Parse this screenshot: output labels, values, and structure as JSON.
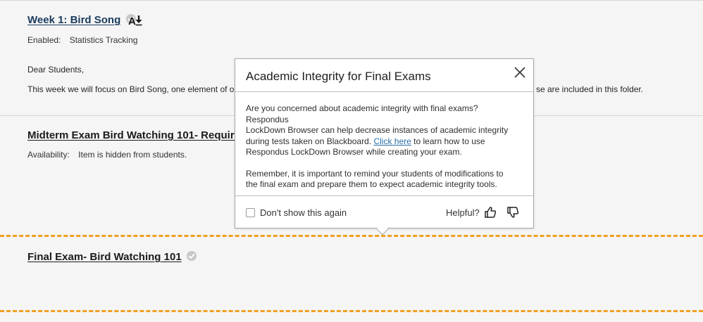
{
  "items": {
    "week1": {
      "title": "Week 1: Bird Song",
      "enabled_label": "Enabled:",
      "enabled_value": "Statistics Tracking",
      "greeting": "Dear Students,",
      "body_left": "This week we will focus on Bird Song, one element of ou",
      "body_right": "se are included in this folder."
    },
    "midterm": {
      "title": "Midterm Exam Bird Watching 101- Requires",
      "availability_label": "Availability:",
      "availability_value": "Item is hidden from students."
    },
    "final": {
      "title": "Final Exam- Bird Watching 101"
    }
  },
  "popup": {
    "title": "Academic Integrity for Final Exams",
    "para1_line1": "Are you concerned about academic integrity with final exams? Respondus",
    "para1_line2": "LockDown Browser can help decrease instances of academic integrity",
    "para1_line3_before": "during tests taken on Blackboard. ",
    "para1_link": "Click here",
    "para1_line3_after": " to learn how to use",
    "para1_line4": "Respondus LockDown Browser while creating your exam.",
    "para2_line1": "Remember, it is important to remind your students of modifications to",
    "para2_line2": "the final exam and prepare them to expect academic integrity tools.",
    "dont_show_label": "Don't show this again",
    "helpful_label": "Helpful?",
    "dont_show_checked": false
  },
  "colors": {
    "accent_dash": "#f0a022",
    "link": "#2a6ea8",
    "week_title": "#1a3a5c"
  },
  "icons": [
    "check-circle-icon",
    "adaptive-release-icon",
    "close-icon",
    "thumbs-up-icon",
    "thumbs-down-icon"
  ]
}
